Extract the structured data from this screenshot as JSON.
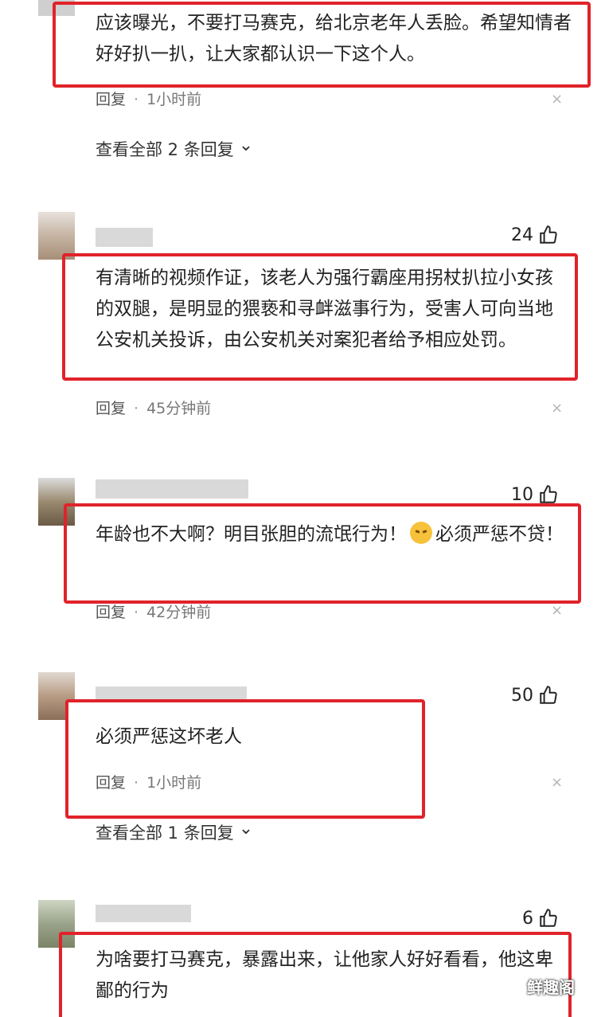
{
  "comments": [
    {
      "text": "应该曝光，不要打马赛克，给北京老年人丢脸。希望知情者好好扒一扒，让大家都认识一下这个人。",
      "reply_label": "回复",
      "time": "1小时前",
      "view_replies": "查看全部 2 条回复"
    },
    {
      "likes": "24",
      "text": "有清晰的视频作证，该老人为强行霸座用拐杖扒拉小女孩的双腿，是明显的猥亵和寻衅滋事行为，受害人可向当地公安机关投诉，由公安机关对案犯者给予相应处罚。",
      "reply_label": "回复",
      "time": "45分钟前"
    },
    {
      "likes": "10",
      "text_before": "年龄也不大啊？明目张胆的流氓行为！",
      "text_after": "必须严惩不贷！",
      "emoji": "angry-face-icon",
      "reply_label": "回复",
      "time": "42分钟前"
    },
    {
      "likes": "50",
      "text": "必须严惩这坏老人",
      "reply_label": "回复",
      "time": "1小时前",
      "view_replies": "查看全部 1 条回复"
    },
    {
      "likes": "6",
      "text": "为啥要打马赛克，暴露出来，让他家人好好看看，他这卑鄙的行为"
    }
  ],
  "close_glyph": "×",
  "chevron_glyph": "⌄",
  "watermark": "鲜趣阁",
  "colors": {
    "highlight_border": "#e0232a"
  }
}
